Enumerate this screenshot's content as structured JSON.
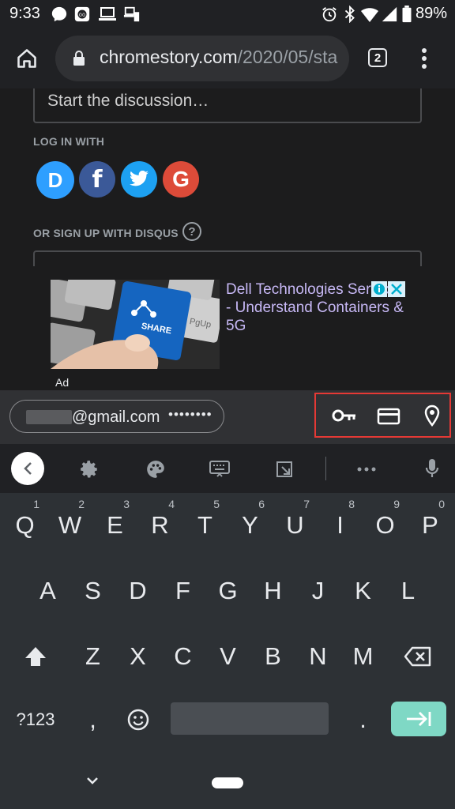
{
  "status_bar": {
    "time": "9:33",
    "battery": "89%"
  },
  "browser": {
    "url_host": "chromestory.com",
    "url_path": "/2020/05/sta",
    "tab_count": "2"
  },
  "page": {
    "discussion_placeholder": "Start the discussion…",
    "login_label": "LOG IN WITH",
    "social_logins": [
      {
        "name": "disqus",
        "letter": "D",
        "color": "#2e9fff"
      },
      {
        "name": "facebook",
        "letter": "f",
        "color": "#3b5998"
      },
      {
        "name": "twitter",
        "color": "#1da1f2"
      },
      {
        "name": "google",
        "letter": "G",
        "color": "#dd4b39"
      }
    ],
    "signup_label": "OR SIGN UP WITH DISQUS",
    "help_symbol": "?"
  },
  "ad": {
    "title": "Dell Technologies Services - Understand Containers & 5G",
    "label": "Ad",
    "image_key_text": "SHARE",
    "image_key_text_2": "PgUp"
  },
  "autofill": {
    "email_suffix": "@gmail.com",
    "password_mask": "••••••••",
    "accessory_icons": [
      "key-icon",
      "credit-card-icon",
      "location-pin-icon"
    ]
  },
  "keyboard": {
    "row1": [
      {
        "key": "Q",
        "hint": "1"
      },
      {
        "key": "W",
        "hint": "2"
      },
      {
        "key": "E",
        "hint": "3"
      },
      {
        "key": "R",
        "hint": "4"
      },
      {
        "key": "T",
        "hint": "5"
      },
      {
        "key": "Y",
        "hint": "6"
      },
      {
        "key": "U",
        "hint": "7"
      },
      {
        "key": "I",
        "hint": "8"
      },
      {
        "key": "O",
        "hint": "9"
      },
      {
        "key": "P",
        "hint": "0"
      }
    ],
    "row2": [
      "A",
      "S",
      "D",
      "F",
      "G",
      "H",
      "J",
      "K",
      "L"
    ],
    "row3": [
      "Z",
      "X",
      "C",
      "V",
      "B",
      "N",
      "M"
    ],
    "symbols_key": "?123",
    "comma_key": ",",
    "period_key": "."
  }
}
